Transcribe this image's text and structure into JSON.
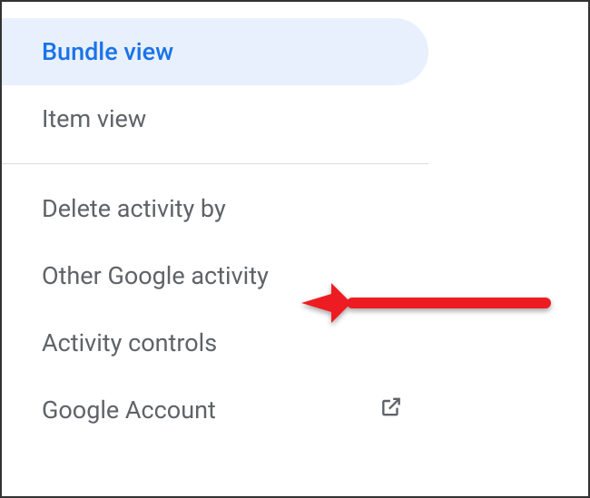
{
  "menu": {
    "items": [
      {
        "label": "Bundle view",
        "selected": true,
        "external": false
      },
      {
        "label": "Item view",
        "selected": false,
        "external": false
      },
      {
        "label": "Delete activity by",
        "selected": false,
        "external": false
      },
      {
        "label": "Other Google activity",
        "selected": false,
        "external": false
      },
      {
        "label": "Activity controls",
        "selected": false,
        "external": false
      },
      {
        "label": "Google Account",
        "selected": false,
        "external": true
      }
    ]
  },
  "colors": {
    "selected_bg": "#e8f0fe",
    "selected_text": "#1a73e8",
    "text": "#5f6368",
    "divider": "#dadce0",
    "arrow": "#ed1c24"
  }
}
